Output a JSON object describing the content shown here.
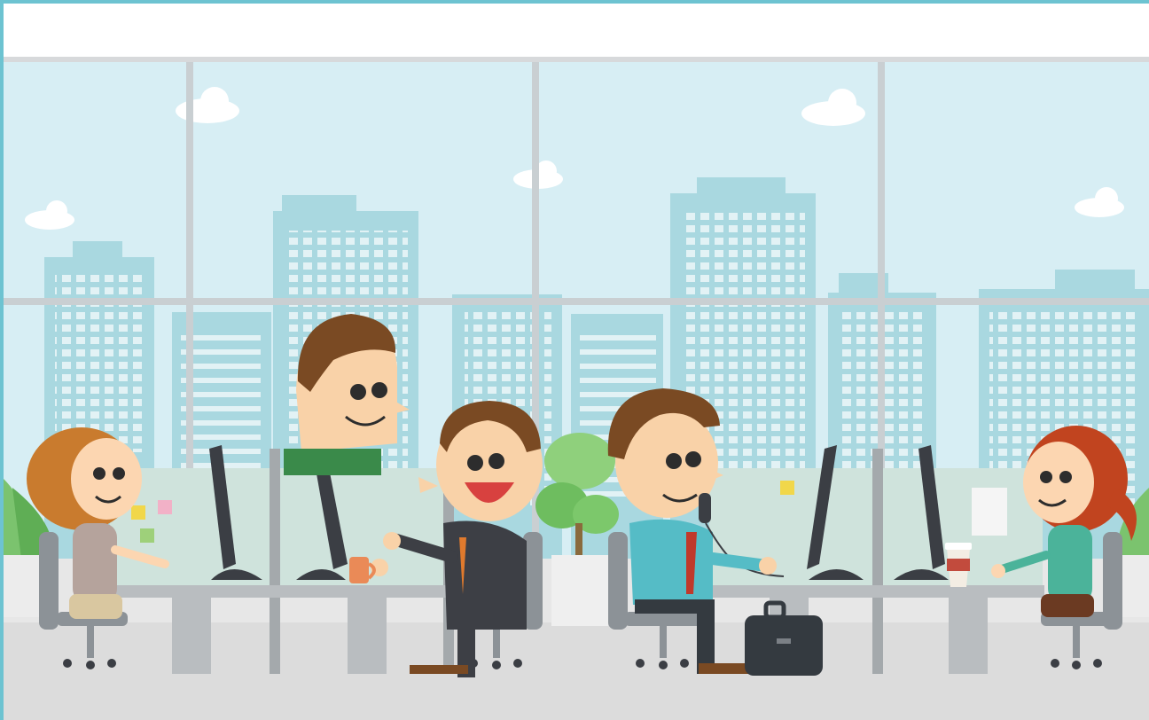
{
  "scene": {
    "description_icons": [
      "cloud-icon",
      "city-skyline",
      "office-worker",
      "computer-monitor",
      "potted-plant",
      "briefcase-icon",
      "coffee-cup-icon",
      "phone-cord",
      "sticky-note"
    ]
  },
  "palette": {
    "sky": "#d7eef4",
    "building": "#a9d8e0",
    "building_window": "#ecf7f9",
    "partition": "#cfe3dc",
    "floor": "#e7e7e7",
    "accent_border": "#6dc3d1"
  }
}
